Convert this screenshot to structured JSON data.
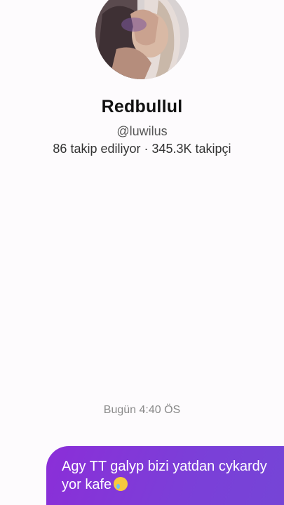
{
  "profile": {
    "display_name": "Redbullul",
    "username": "@luwilus",
    "stats": "86 takip ediliyor · 345.3K takipçi"
  },
  "chat": {
    "timestamp": "Bugün 4:40 ÖS",
    "message_line1": "Agy TT galyp bizi yatdan cykardy",
    "message_line2": "yor kafe",
    "message_emoji": "crying-face-emoji"
  },
  "colors": {
    "background": "#fdfbfd",
    "bubble_start": "#8b2ed8",
    "bubble_end": "#7446d6"
  }
}
